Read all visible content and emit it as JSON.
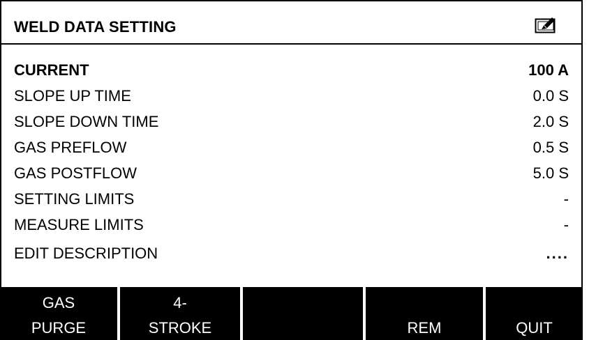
{
  "header": {
    "title": "WELD DATA SETTING",
    "icon": "edit-icon"
  },
  "settings": [
    {
      "label": "CURRENT",
      "value": "100 A",
      "selected": true
    },
    {
      "label": "SLOPE UP TIME",
      "value": "0.0 S"
    },
    {
      "label": "SLOPE DOWN TIME",
      "value": "2.0 S"
    },
    {
      "label": "GAS PREFLOW",
      "value": "0.5 S"
    },
    {
      "label": "GAS POSTFLOW",
      "value": "5.0 S"
    },
    {
      "label": "SETTING LIMITS",
      "value": "-"
    },
    {
      "label": "MEASURE LIMITS",
      "value": "-"
    },
    {
      "label": "EDIT DESCRIPTION",
      "value": "...."
    }
  ],
  "softkeys": [
    {
      "line1": "GAS",
      "line2": "PURGE"
    },
    {
      "line1": "4-",
      "line2": "STROKE"
    },
    {
      "line1": "",
      "line2": ""
    },
    {
      "line1": "",
      "line2": "REM"
    },
    {
      "line1": "",
      "line2": "QUIT"
    }
  ],
  "colors": {
    "background": "#ffffff",
    "text": "#000000",
    "softkey_bar": "#000000",
    "softkey_text": "#ffffff"
  }
}
